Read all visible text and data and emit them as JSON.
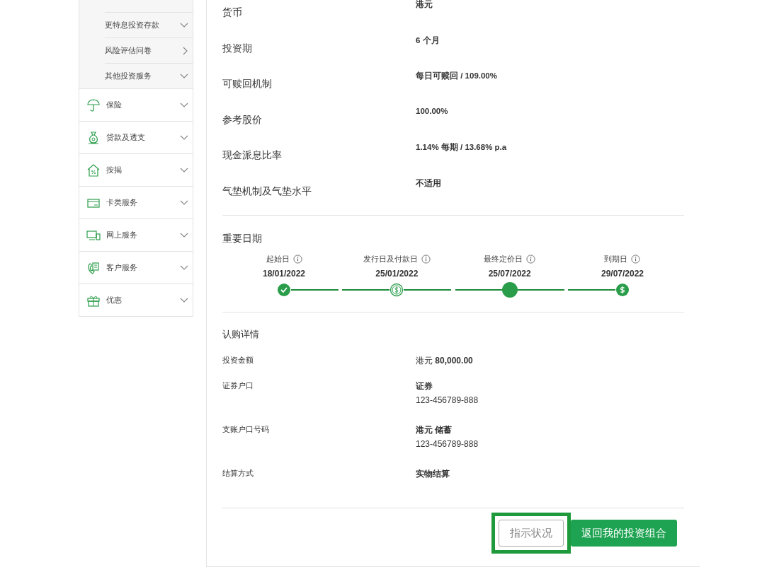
{
  "sidebar": {
    "sub_items": [
      {
        "label": "更特息投资存款",
        "kind": "dropdown"
      },
      {
        "label": "风险评估问卷",
        "kind": "link"
      },
      {
        "label": "其他投资服务",
        "kind": "dropdown"
      }
    ],
    "items": [
      {
        "label": "保险",
        "kind": "umbrella"
      },
      {
        "label": "贷款及透支",
        "kind": "moneybag"
      },
      {
        "label": "按揭",
        "kind": "house"
      },
      {
        "label": "卡类服务",
        "kind": "card"
      },
      {
        "label": "网上服务",
        "kind": "devices"
      },
      {
        "label": "客户服务",
        "kind": "phone"
      },
      {
        "label": "优惠",
        "kind": "gift"
      }
    ]
  },
  "details": [
    {
      "label": "货币",
      "value": "港元"
    },
    {
      "label": "投资期",
      "value": "6 个月"
    },
    {
      "label": "可赎回机制",
      "value": "每日可赎回 / 109.00%"
    },
    {
      "label": "参考股价",
      "value": "100.00%"
    },
    {
      "label": "现金派息比率",
      "value": "1.14% 每期 / 13.68% p.a"
    },
    {
      "label": "气垫机制及气垫水平",
      "value": "不适用"
    }
  ],
  "key_dates": {
    "title": "重要日期",
    "steps": [
      {
        "label": "起始日",
        "date": "18/01/2022",
        "kind": "check"
      },
      {
        "label": "发行日及付款日",
        "date": "25/01/2022",
        "kind": "dollar-outline"
      },
      {
        "label": "最终定价日",
        "date": "25/07/2022",
        "kind": "current"
      },
      {
        "label": "到期日",
        "date": "29/07/2022",
        "kind": "dollar"
      }
    ]
  },
  "subscription": {
    "title": "认购详情",
    "rows": [
      {
        "label": "投资金额",
        "value": "港元 **80,000.00**",
        "sub": null
      },
      {
        "label": "证券户口",
        "value": "**证券**",
        "sub": "123-456789-888"
      },
      {
        "label": "支账户口号码",
        "value": "**港元 储蓄**",
        "sub": "123-456789-888"
      },
      {
        "label": "结算方式",
        "value": "**实物结算**",
        "sub": null
      }
    ]
  },
  "buttons": [
    {
      "label": "指示状况",
      "kind": "secondary",
      "highlighted": true
    },
    {
      "label": "返回我的投资组合",
      "kind": "primary",
      "highlighted": false
    }
  ]
}
